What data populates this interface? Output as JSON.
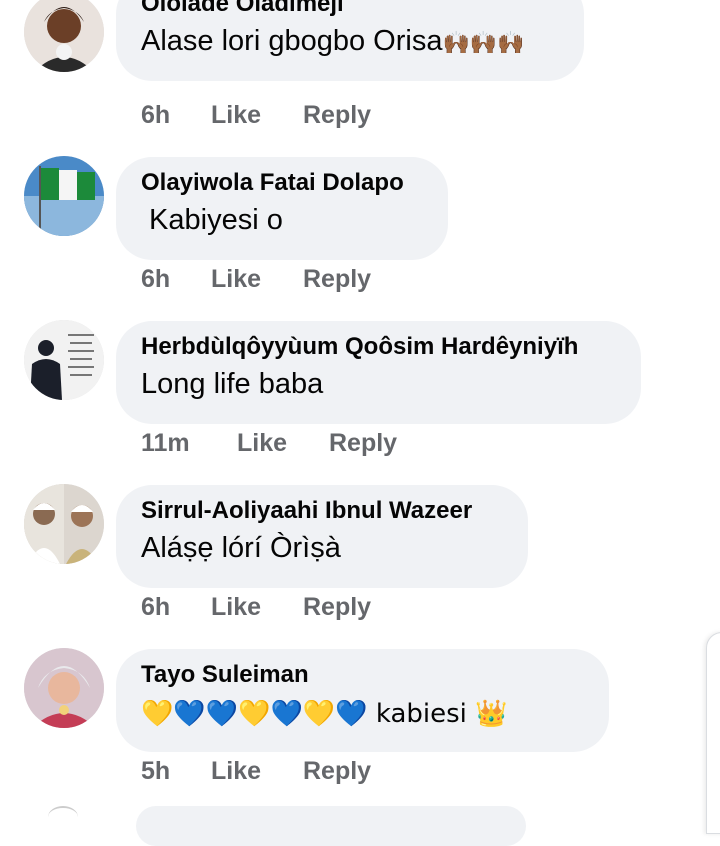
{
  "comments": [
    {
      "name": "Ololade Oladimeji",
      "text": "Alase lori gbogbo Orisa",
      "emoji": "🙌🏾🙌🏾🙌🏾",
      "time": "6h",
      "like": "Like",
      "reply": "Reply",
      "avatar": "woman-portrait"
    },
    {
      "name": "Olayiwola Fatai Dolapo",
      "text": " Kabiyesi o",
      "time": "6h",
      "like": "Like",
      "reply": "Reply",
      "avatar": "nigeria-flag"
    },
    {
      "name": "Herbdùlqôyyùum Qoôsim Hardêyniyïh",
      "text": "Long life baba",
      "time": "11m",
      "like": "Like",
      "reply": "Reply",
      "avatar": "silhouette-quote"
    },
    {
      "name": "Sirrul-Aoliyaahi Ibnul Wazeer",
      "text": "Aláṣẹ lórí Òrìṣà",
      "time": "6h",
      "like": "Like",
      "reply": "Reply",
      "avatar": "men-white-caps"
    },
    {
      "name": "Tayo Suleiman",
      "text": "💛💙💙💛💙💛💙 kabiesi 👑",
      "time": "5h",
      "like": "Like",
      "reply": "Reply",
      "avatar": "woman-portrait-2"
    }
  ],
  "colors": {
    "bubble": "#f0f2f5",
    "name": "#050505",
    "meta": "#65676b"
  }
}
